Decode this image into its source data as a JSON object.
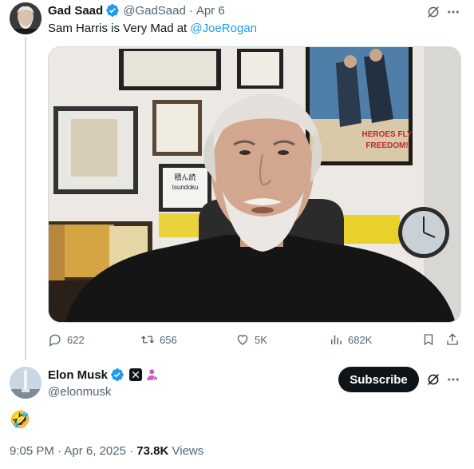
{
  "tweet": {
    "author_name": "Gad Saad",
    "author_handle": "@GadSaad",
    "separator": "·",
    "date": "Apr 6",
    "text_prefix": "Sam Harris is Very Mad at ",
    "text_mention": "@JoeRogan",
    "stats": {
      "replies": "622",
      "reposts": "656",
      "likes": "5K",
      "views": "682K"
    }
  },
  "poster_text": {
    "line1": "HEROES FLY",
    "line2": "FREEDOM!"
  },
  "book_label": "tsundoku",
  "reply": {
    "author_name": "Elon Musk",
    "author_handle": "@elonmusk",
    "subscribe_label": "Subscribe",
    "emoji": "🤣",
    "time": "9:05 PM",
    "separator": "·",
    "date": "Apr 6, 2025",
    "views_count": "73.8K",
    "views_label": "Views"
  },
  "colors": {
    "accent": "#1d9bf0",
    "muted_text": "#536471",
    "primary_text": "#0f1419",
    "badge_purple": "#c85ad6"
  },
  "icons": [
    "verified-badge-icon",
    "grok-icon",
    "more-icon",
    "reply-icon",
    "repost-icon",
    "like-icon",
    "views-icon",
    "bookmark-icon",
    "share-icon",
    "x-logo-icon",
    "affiliate-icon"
  ]
}
